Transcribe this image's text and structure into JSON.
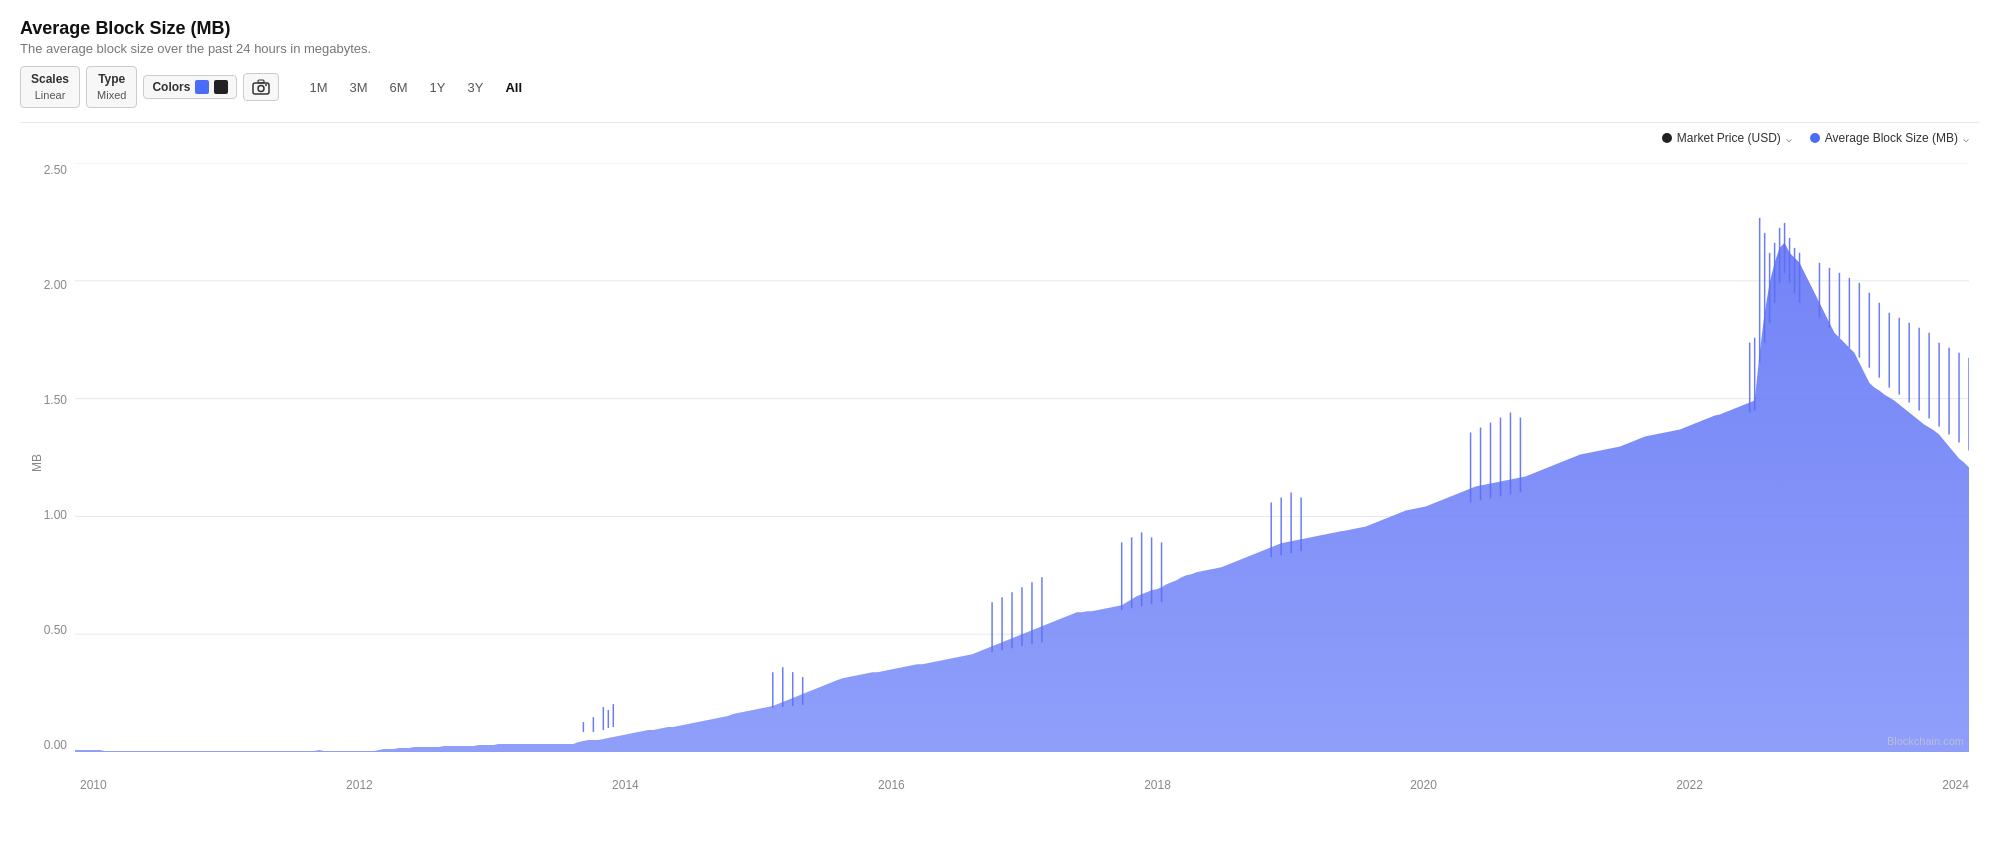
{
  "header": {
    "title": "Average Block Size (MB)",
    "subtitle": "The average block size over the past 24 hours in megabytes."
  },
  "toolbar": {
    "scales_label": "Scales",
    "scales_sub": "Linear",
    "type_label": "Type",
    "type_sub": "Mixed",
    "colors_label": "Colors",
    "camera_icon": "📷",
    "time_buttons": [
      "1M",
      "3M",
      "6M",
      "1Y",
      "3Y",
      "All"
    ],
    "active_time": "All"
  },
  "legend": {
    "item1_label": "Market Price (USD)",
    "item2_label": "Average Block Size (MB)"
  },
  "y_axis": {
    "labels": [
      "2.50",
      "2.00",
      "1.50",
      "1.00",
      "0.50",
      "0.00"
    ],
    "unit": "MB"
  },
  "x_axis": {
    "labels": [
      "2010",
      "2012",
      "2014",
      "2016",
      "2018",
      "2020",
      "2022",
      "2024"
    ]
  },
  "watermark": "Blockchain.com"
}
